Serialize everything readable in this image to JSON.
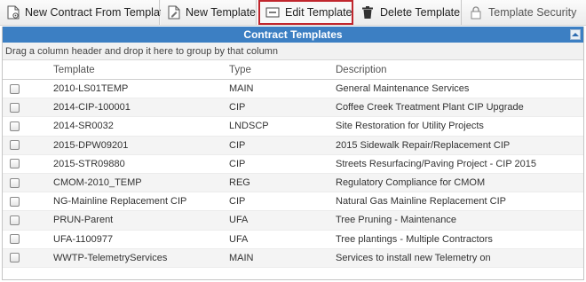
{
  "toolbar": {
    "buttons": [
      {
        "label": "New Contract From Template",
        "icon": "document-gear-icon"
      },
      {
        "label": "New Template",
        "icon": "document-edit-icon"
      },
      {
        "label": "Edit Template",
        "icon": "edit-box-icon"
      },
      {
        "label": "Delete Template",
        "icon": "trash-icon"
      },
      {
        "label": "Template Security",
        "icon": "lock-icon"
      }
    ]
  },
  "grid": {
    "title": "Contract Templates",
    "group_hint": "Drag a column header and drop it here to group by that column",
    "columns": [
      "Template",
      "Type",
      "Description"
    ],
    "rows": [
      {
        "template": "2010-LS01TEMP",
        "type": "MAIN",
        "description": "General Maintenance Services"
      },
      {
        "template": "2014-CIP-100001",
        "type": "CIP",
        "description": "Coffee Creek Treatment Plant CIP Upgrade"
      },
      {
        "template": "2014-SR0032",
        "type": "LNDSCP",
        "description": "Site Restoration for Utility Projects"
      },
      {
        "template": "2015-DPW09201",
        "type": "CIP",
        "description": "2015 Sidewalk Repair/Replacement CIP"
      },
      {
        "template": "2015-STR09880",
        "type": "CIP",
        "description": "Streets Resurfacing/Paving Project - CIP 2015"
      },
      {
        "template": "CMOM-2010_TEMP",
        "type": "REG",
        "description": "Regulatory Compliance for CMOM"
      },
      {
        "template": "NG-Mainline Replacement CIP",
        "type": "CIP",
        "description": "Natural Gas Mainline Replacement CIP"
      },
      {
        "template": "PRUN-Parent",
        "type": "UFA",
        "description": "Tree Pruning - Maintenance"
      },
      {
        "template": "UFA-1100977",
        "type": "UFA",
        "description": "Tree plantings - Multiple Contractors"
      },
      {
        "template": "WWTP-TelemetryServices",
        "type": "MAIN",
        "description": "Services to install new Telemetry on"
      }
    ]
  },
  "colors": {
    "header_blue": "#3c7fc3",
    "highlight_red": "#c0262d"
  }
}
